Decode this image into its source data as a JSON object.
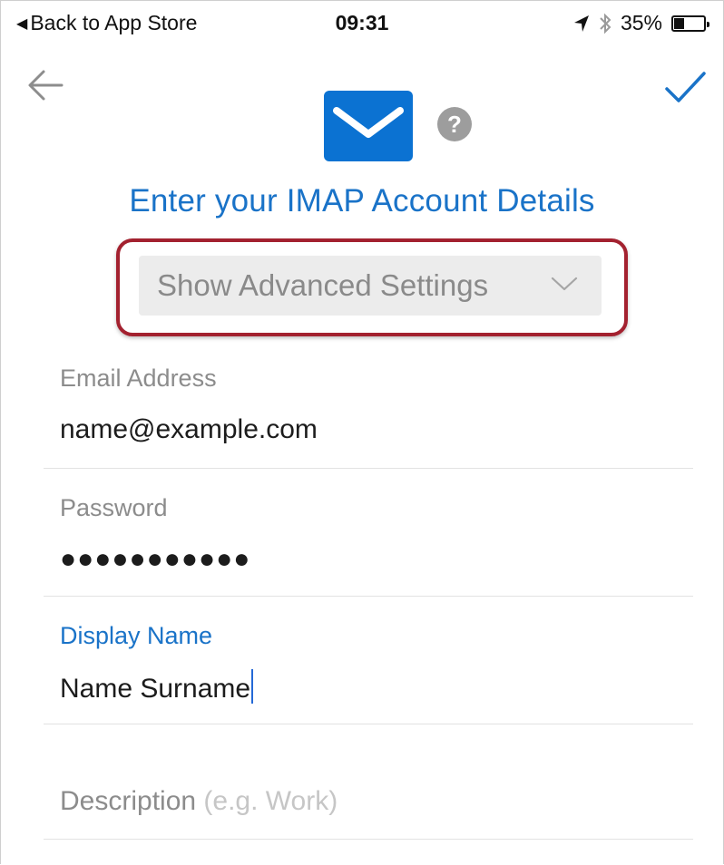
{
  "status_bar": {
    "back_label": "Back to App Store",
    "time": "09:31",
    "battery_text": "35%",
    "battery_level": 0.35
  },
  "nav": {
    "back_icon": "arrow-left-icon",
    "done_icon": "checkmark-icon"
  },
  "header": {
    "logo_icon": "mail-envelope-icon",
    "help_icon": "question-mark-icon",
    "help_glyph": "?",
    "title": "Enter your IMAP Account Details"
  },
  "advanced_button": {
    "label": "Show Advanced Settings",
    "icon": "chevron-down-icon"
  },
  "form": {
    "email": {
      "label": "Email Address",
      "value": "name@example.com"
    },
    "password": {
      "label": "Password",
      "value": "●●●●●●●●●●●"
    },
    "display_name": {
      "label": "Display Name",
      "value": "Name Surname"
    },
    "description": {
      "label": "Description",
      "hint": "(e.g. Work)"
    }
  },
  "colors": {
    "accent": "#1a73c8",
    "logo_blue": "#0b72d2",
    "highlight": "#a3212f"
  }
}
